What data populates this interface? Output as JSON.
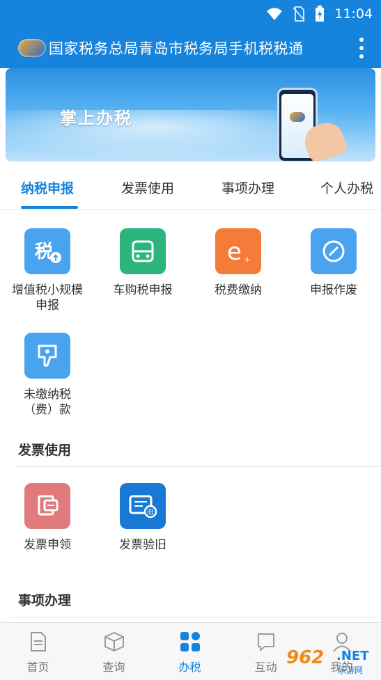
{
  "status_bar": {
    "time": "11:04",
    "icons": [
      "wifi-icon",
      "no-sim-icon",
      "battery-charging-icon"
    ]
  },
  "app_bar": {
    "logo_icon": "tax-app-logo-icon",
    "title": "国家税务总局青岛市税务局手机税税通",
    "menu_icon": "more-vert-icon"
  },
  "banner": {
    "title": "掌上办税"
  },
  "tabs": [
    {
      "label": "纳税申报",
      "active": true
    },
    {
      "label": "发票使用",
      "active": false
    },
    {
      "label": "事项办理",
      "active": false
    },
    {
      "label": "个人办税",
      "active": false
    }
  ],
  "tax_filing": {
    "items": [
      {
        "label": "增值税小规模申报",
        "icon": "tax-upload-icon",
        "color": "#4aa3ee"
      },
      {
        "label": "车购税申报",
        "icon": "car-icon",
        "color": "#2bb47b"
      },
      {
        "label": "税费缴纳",
        "icon": "e-pay-icon",
        "color": "#f57c38"
      },
      {
        "label": "申报作废",
        "icon": "cancel-circle-icon",
        "color": "#4aa3ee"
      },
      {
        "label": "未缴纳税（费）款",
        "icon": "unpaid-tax-icon",
        "color": "#4aa3ee"
      }
    ]
  },
  "invoice_section": {
    "title": "发票使用",
    "items": [
      {
        "label": "发票申领",
        "icon": "invoice-apply-icon",
        "color": "#e07a7d"
      },
      {
        "label": "发票验旧",
        "icon": "invoice-verify-icon",
        "color": "#1878d6"
      }
    ]
  },
  "matters_section": {
    "title": "事项办理"
  },
  "bottom_nav": [
    {
      "label": "首页",
      "icon": "document-icon",
      "active": false
    },
    {
      "label": "查询",
      "icon": "box-icon",
      "active": false
    },
    {
      "label": "办税",
      "icon": "grid-icon",
      "active": true
    },
    {
      "label": "互动",
      "icon": "chat-square-icon",
      "active": false
    },
    {
      "label": "我的",
      "icon": "user-icon",
      "active": false
    }
  ],
  "watermark": {
    "number": "962",
    "suffix": ".NET",
    "sub": "乐游网"
  },
  "colors": {
    "primary": "#1683dc",
    "text": "#333333",
    "muted": "#777777"
  }
}
